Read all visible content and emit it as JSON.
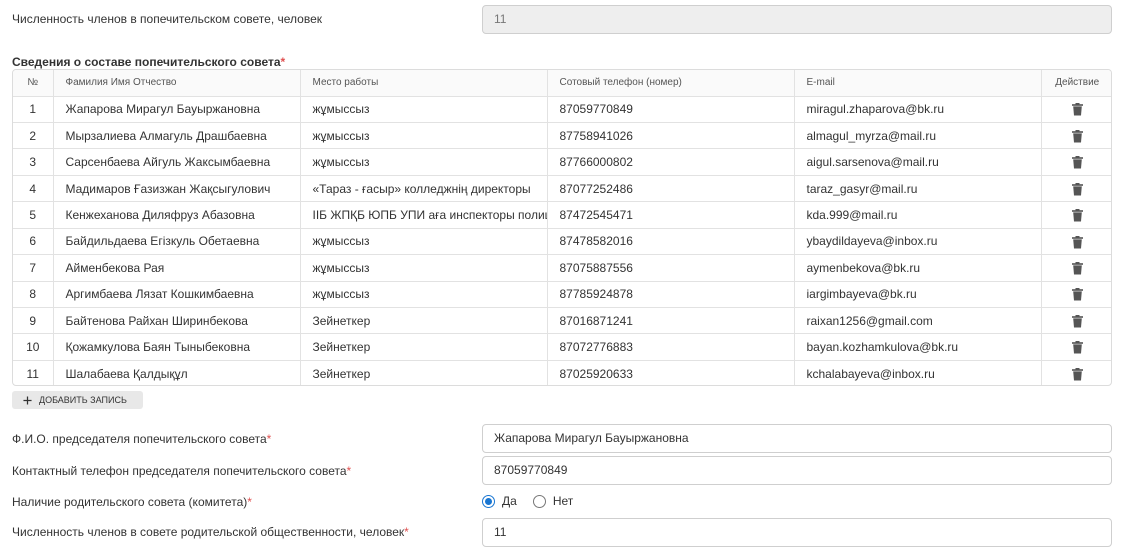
{
  "top": {
    "label": "Численность членов в попечительском совете, человек",
    "value": "11"
  },
  "board": {
    "title": "Сведения о составе попечительского совета",
    "required_mark": "*",
    "columns": [
      "№",
      "Фамилия Имя Отчество",
      "Место работы",
      "Сотовый телефон (номер)",
      "E-mail",
      "Действие"
    ],
    "rows": [
      [
        "1",
        "Жапарова Мирагул Бауыржановна",
        "жұмыссыз",
        "87059770849",
        "miragul.zhaparova@bk.ru"
      ],
      [
        "2",
        "Мырзалиева Алмагуль Драшбаевна",
        "жұмыссыз",
        "87758941026",
        "almagul_myrza@mail.ru"
      ],
      [
        "3",
        "Сарсенбаева Айгуль Жаксымбаевна",
        "жұмыссыз",
        "87766000802",
        "aigul.sarsenova@mail.ru"
      ],
      [
        "4",
        "Мадимаров Ғазизжан Жақсыгулович",
        "«Тараз - ғасыр» колледжнің директоры",
        "87077252486",
        "taraz_gasyr@mail.ru"
      ],
      [
        "5",
        "Кенжеханова Диляфруз Абазовна",
        "ІІБ ЖПҚБ ЮПБ УПИ аға инспекторы полиции",
        "87472545471",
        "kda.999@mail.ru"
      ],
      [
        "6",
        "Байдильдаева Егізкуль Обетаевна",
        "жұмыссыз",
        "87478582016",
        "ybaydildayeva@inbox.ru"
      ],
      [
        "7",
        "Айменбекова Рая",
        "жұмыссыз",
        "87075887556",
        "aymenbekova@bk.ru"
      ],
      [
        "8",
        "Аргимбаева Лязат Кошкимбаевна",
        "жұмыссыз",
        "87785924878",
        "iargimbayeva@bk.ru"
      ],
      [
        "9",
        "Байтенова Райхан Ширинбекова",
        "Зейнеткер",
        "87016871241",
        "raixan1256@gmail.com"
      ],
      [
        "10",
        "Қожамкулова Баян Тыныбековна",
        "Зейнеткер",
        "87072776883",
        "bayan.kozhamkulova@bk.ru"
      ],
      [
        "11",
        "Шалабаева Қалдықұл",
        "Зейнеткер",
        "87025920633",
        "kchalabayeva@inbox.ru"
      ]
    ],
    "add_button": "Добавить запись"
  },
  "chair": {
    "name_label": "Ф.И.О. председателя попечительского совета",
    "name_value": "Жапарова Мирагул Бауыржановна",
    "phone_label": "Контактный телефон председателя попечительского совета",
    "phone_value": "87059770849"
  },
  "parent_council": {
    "label": "Наличие родительского совета (комитета)",
    "options": [
      "Да",
      "Нет"
    ],
    "selected": "Да",
    "members_label": "Численность членов в совете родительской общественности, человек",
    "members_value": "11"
  },
  "icons": {
    "delete": "trash-icon",
    "add": "plus-icon"
  },
  "colors": {
    "required": "#e05050",
    "radio_checked": "#1976d2"
  }
}
